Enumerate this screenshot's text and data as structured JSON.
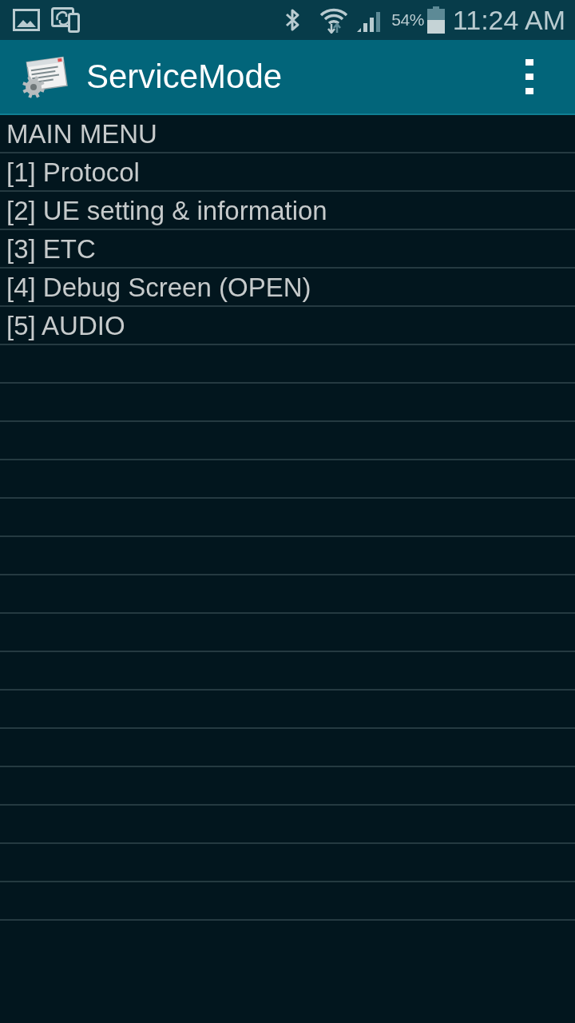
{
  "status_bar": {
    "battery_percent": "54%",
    "time": "11:24 AM"
  },
  "app_bar": {
    "title": "ServiceMode"
  },
  "menu": {
    "header": "MAIN MENU",
    "items": [
      "[1] Protocol",
      "[2] UE setting & information",
      "[3] ETC",
      "[4] Debug Screen (OPEN)",
      "[5] AUDIO"
    ]
  }
}
